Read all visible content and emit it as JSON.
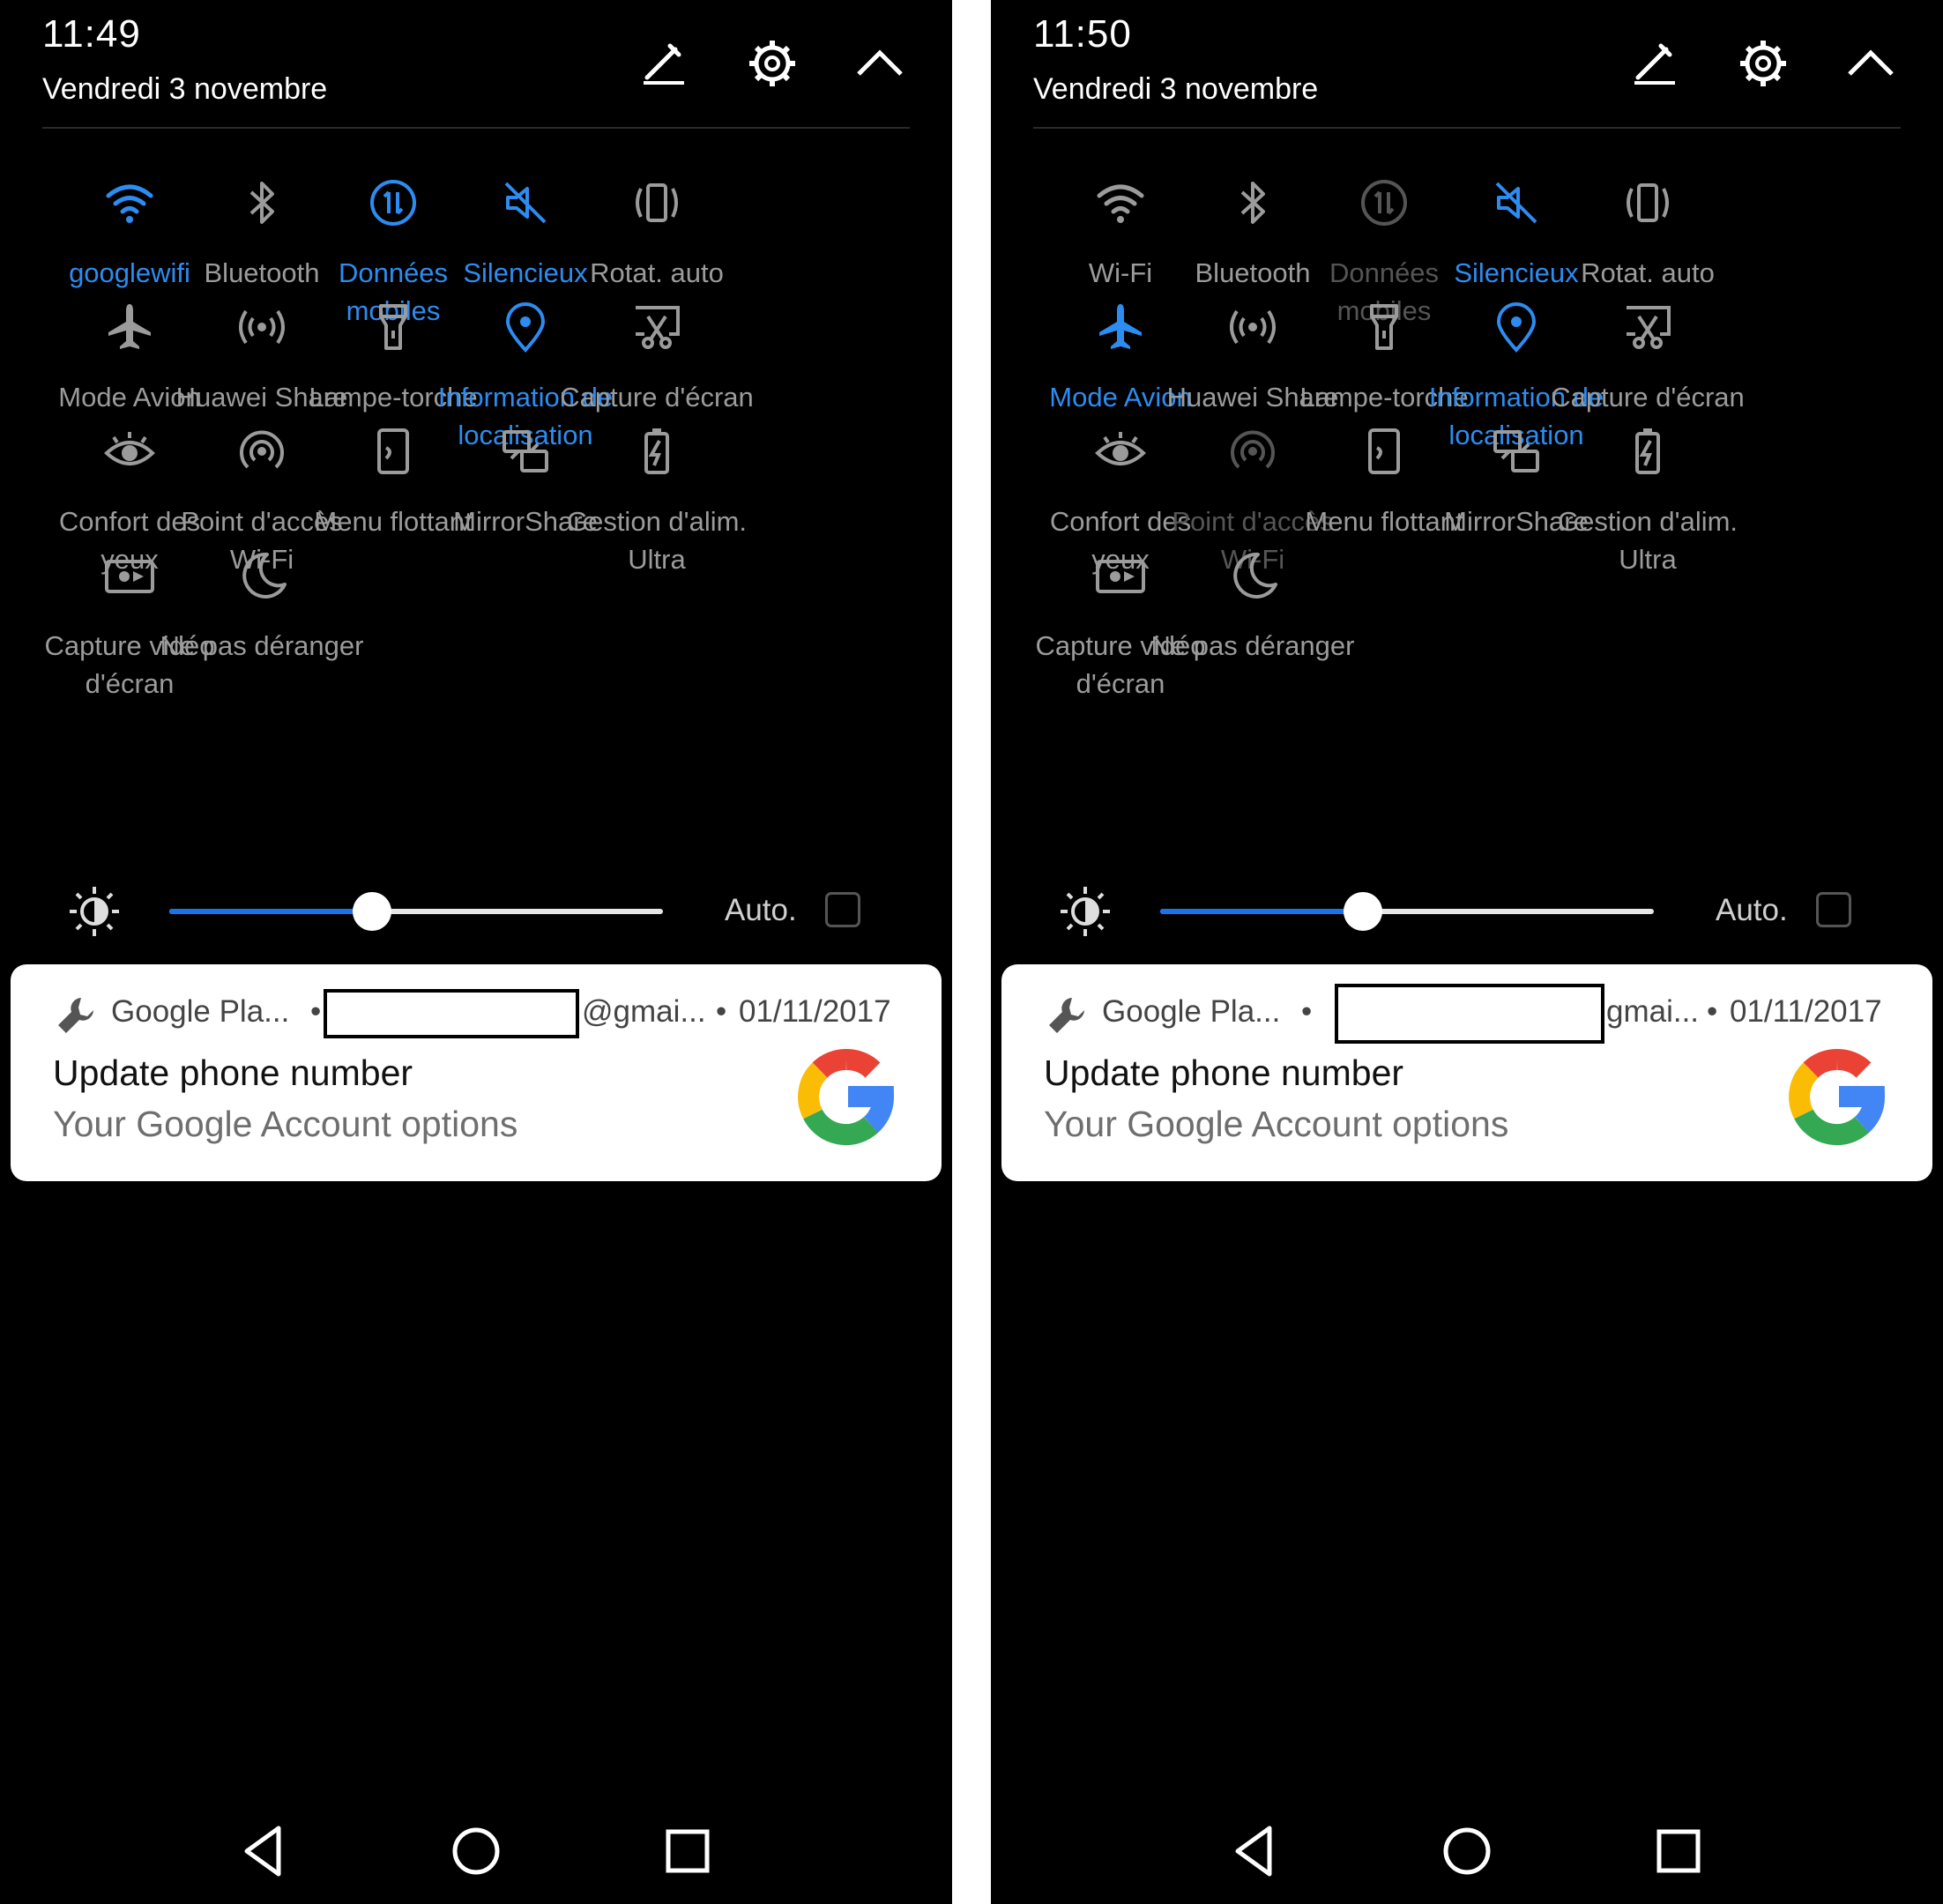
{
  "colors": {
    "accent": "#2d8cf0",
    "inactive": "#9b9b9b",
    "disabled": "#555555",
    "background": "#000000"
  },
  "panels": [
    {
      "time": "11:49",
      "date": "Vendredi 3 novembre",
      "tiles": [
        {
          "label": "googlewifi",
          "icon": "wifi-icon",
          "state": "on"
        },
        {
          "label": "Bluetooth",
          "icon": "bluetooth-icon",
          "state": "off"
        },
        {
          "label": "Données mobiles",
          "icon": "mobile-data-icon",
          "state": "on"
        },
        {
          "label": "Silencieux",
          "icon": "silent-icon",
          "state": "on"
        },
        {
          "label": "Rotat. auto",
          "icon": "auto-rotate-icon",
          "state": "off"
        },
        {
          "label": "Mode Avion",
          "icon": "airplane-icon",
          "state": "off"
        },
        {
          "label": "Huawei Share",
          "icon": "huawei-share-icon",
          "state": "off"
        },
        {
          "label": "Lampe-torche",
          "icon": "flashlight-icon",
          "state": "off"
        },
        {
          "label": "Information de localisation",
          "icon": "location-icon",
          "state": "on"
        },
        {
          "label": "Capture d'écran",
          "icon": "screenshot-icon",
          "state": "off"
        },
        {
          "label": "Confort des yeux",
          "icon": "eye-comfort-icon",
          "state": "off"
        },
        {
          "label": "Point d'accès Wi-Fi",
          "icon": "hotspot-icon",
          "state": "off"
        },
        {
          "label": "Menu flottant",
          "icon": "floating-menu-icon",
          "state": "off"
        },
        {
          "label": "MirrorShare",
          "icon": "mirrorshare-icon",
          "state": "off"
        },
        {
          "label": "Gestion d'alim. Ultra",
          "icon": "ultra-power-icon",
          "state": "off"
        },
        {
          "label": "Capture vidéo d'écran",
          "icon": "screen-record-icon",
          "state": "off"
        },
        {
          "label": "Ne pas déranger",
          "icon": "do-not-disturb-icon",
          "state": "off"
        }
      ],
      "brightness": {
        "level": 0.41,
        "auto_label": "Auto.",
        "auto_checked": false
      },
      "notification": {
        "app": "Google Pla...",
        "separator": "•",
        "account": "@gmai...",
        "date": "01/11/2017",
        "title": "Update phone number",
        "subtitle": "Your Google Account options"
      }
    },
    {
      "time": "11:50",
      "date": "Vendredi 3 novembre",
      "tiles": [
        {
          "label": "Wi-Fi",
          "icon": "wifi-icon",
          "state": "off"
        },
        {
          "label": "Bluetooth",
          "icon": "bluetooth-icon",
          "state": "off"
        },
        {
          "label": "Données mobiles",
          "icon": "mobile-data-icon",
          "state": "dim"
        },
        {
          "label": "Silencieux",
          "icon": "silent-icon",
          "state": "on"
        },
        {
          "label": "Rotat. auto",
          "icon": "auto-rotate-icon",
          "state": "off"
        },
        {
          "label": "Mode Avion",
          "icon": "airplane-icon",
          "state": "on"
        },
        {
          "label": "Huawei Share",
          "icon": "huawei-share-icon",
          "state": "off"
        },
        {
          "label": "Lampe-torche",
          "icon": "flashlight-icon",
          "state": "off"
        },
        {
          "label": "Information de localisation",
          "icon": "location-icon",
          "state": "on"
        },
        {
          "label": "Capture d'écran",
          "icon": "screenshot-icon",
          "state": "off"
        },
        {
          "label": "Confort des yeux",
          "icon": "eye-comfort-icon",
          "state": "off"
        },
        {
          "label": "Point d'accès Wi-Fi",
          "icon": "hotspot-icon",
          "state": "dim"
        },
        {
          "label": "Menu flottant",
          "icon": "floating-menu-icon",
          "state": "off"
        },
        {
          "label": "MirrorShare",
          "icon": "mirrorshare-icon",
          "state": "off"
        },
        {
          "label": "Gestion d'alim. Ultra",
          "icon": "ultra-power-icon",
          "state": "off"
        },
        {
          "label": "Capture vidéo d'écran",
          "icon": "screen-record-icon",
          "state": "off"
        },
        {
          "label": "Ne pas déranger",
          "icon": "do-not-disturb-icon",
          "state": "off"
        }
      ],
      "brightness": {
        "level": 0.41,
        "auto_label": "Auto.",
        "auto_checked": false
      },
      "notification": {
        "app": "Google Pla...",
        "separator": "•",
        "account": "gmai...",
        "date": "01/11/2017",
        "title": "Update phone number",
        "subtitle": "Your Google Account options"
      }
    }
  ]
}
